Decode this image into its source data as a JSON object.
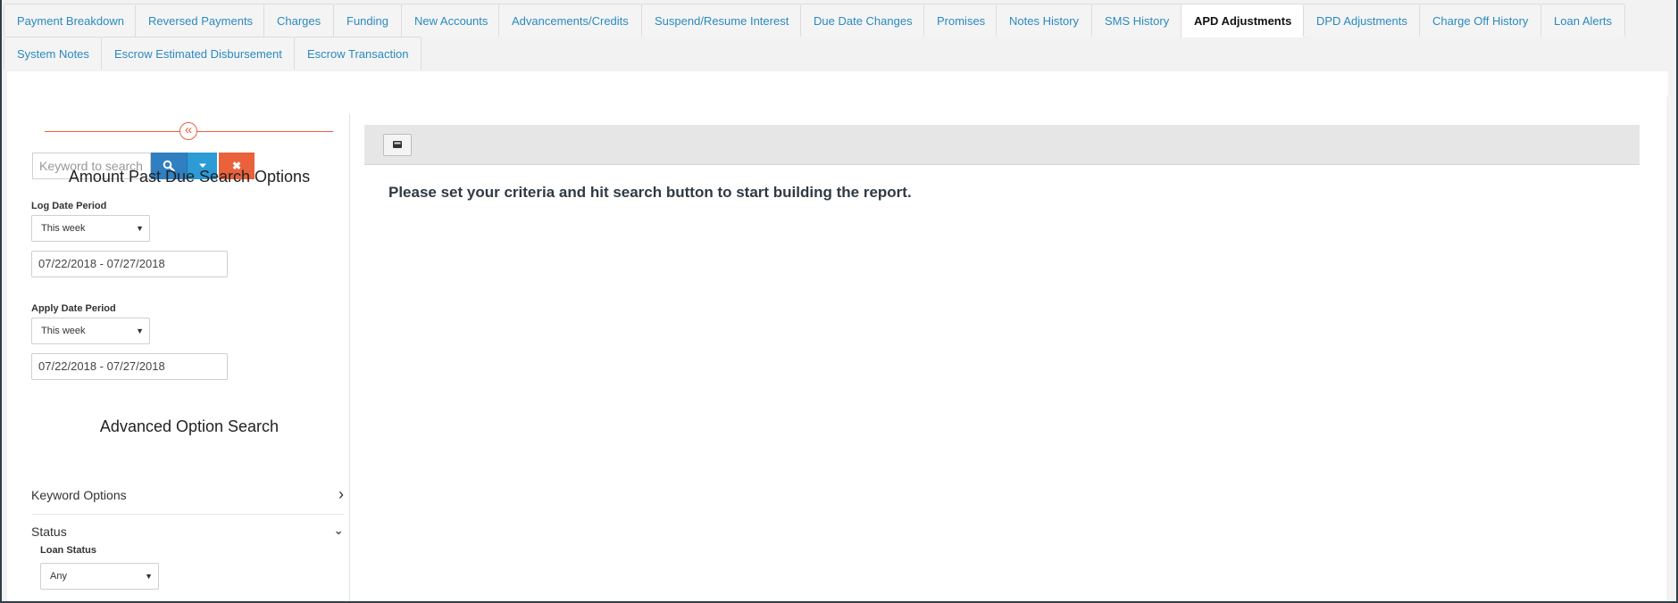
{
  "tabs": [
    {
      "label": "Payment Breakdown",
      "active": false
    },
    {
      "label": "Reversed Payments",
      "active": false
    },
    {
      "label": "Charges",
      "active": false
    },
    {
      "label": "Funding",
      "active": false
    },
    {
      "label": "New Accounts",
      "active": false
    },
    {
      "label": "Advancements/Credits",
      "active": false
    },
    {
      "label": "Suspend/Resume Interest",
      "active": false
    },
    {
      "label": "Due Date Changes",
      "active": false
    },
    {
      "label": "Promises",
      "active": false
    },
    {
      "label": "Notes History",
      "active": false
    },
    {
      "label": "SMS History",
      "active": false
    },
    {
      "label": "APD Adjustments",
      "active": true
    },
    {
      "label": "DPD Adjustments",
      "active": false
    },
    {
      "label": "Charge Off History",
      "active": false
    },
    {
      "label": "Loan Alerts",
      "active": false
    },
    {
      "label": "System Notes",
      "active": false
    },
    {
      "label": "Escrow Estimated Disbursement",
      "active": false
    },
    {
      "label": "Escrow Transaction",
      "active": false
    }
  ],
  "search": {
    "placeholder": "Keyword to search",
    "search_icon": "search-icon",
    "dropdown_icon": "caret-down-icon",
    "clear_label": "✖"
  },
  "left_panel": {
    "collapse_icon": "«",
    "heading": "Amount Past Due Search Options",
    "log_date": {
      "label": "Log Date Period",
      "select_value": "This week",
      "range": "07/22/2018 - 07/27/2018"
    },
    "apply_date": {
      "label": "Apply Date Period",
      "select_value": "This week",
      "range": "07/22/2018 - 07/27/2018"
    },
    "advanced_heading": "Advanced Option Search",
    "keyword_options": "Keyword Options",
    "status": "Status",
    "loan_status": {
      "label": "Loan Status",
      "select_value": "Any"
    }
  },
  "main": {
    "message": "Please set your criteria and hit search button to start building the report.",
    "toolbar_icon": "book-icon"
  },
  "colors": {
    "tab_text": "#2a8ac0",
    "search_button": "#2f7fc1",
    "dropdown_button": "#2c9bd6",
    "clear_button": "#e9623c",
    "accent_line": "#e8623f"
  }
}
